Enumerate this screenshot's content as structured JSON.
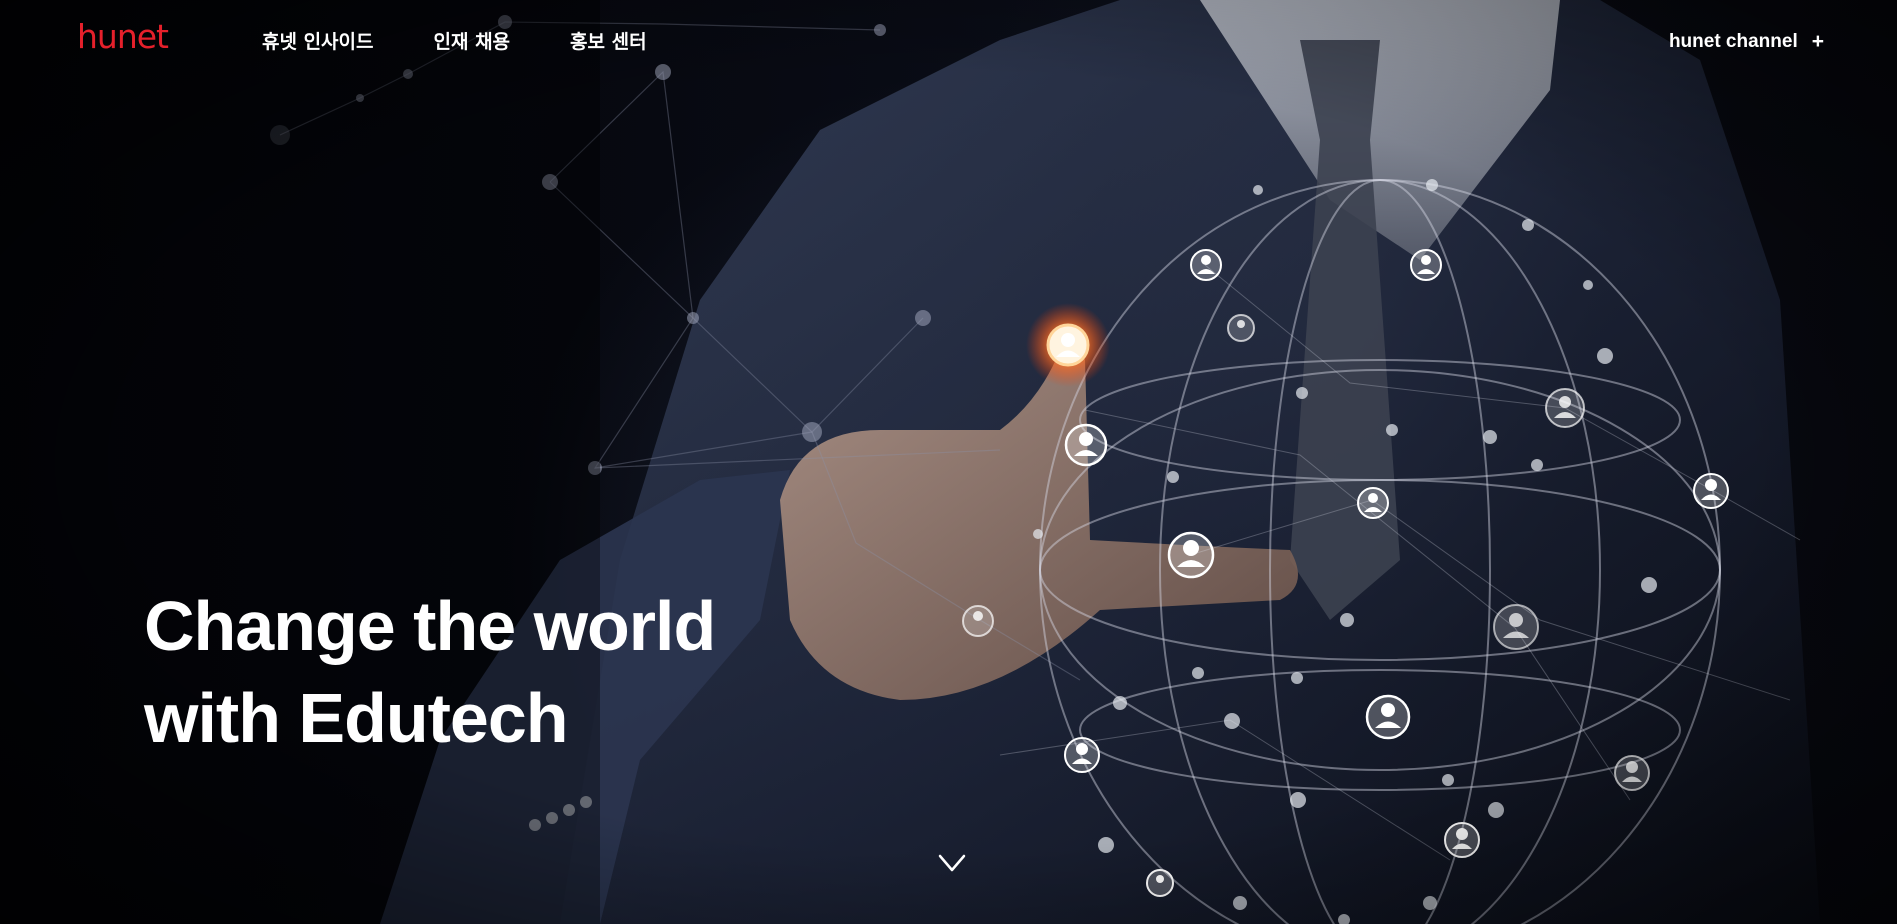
{
  "header": {
    "logo_text": "hunet",
    "nav": [
      {
        "label": "휴넷 인사이드"
      },
      {
        "label": "인재 채용"
      },
      {
        "label": "홍보 센터"
      }
    ],
    "channel_label": "hunet channel",
    "channel_icon": "plus-icon"
  },
  "hero": {
    "headline_line1": "Change the world",
    "headline_line2": "with Edutech",
    "scroll_icon": "chevron-down-icon"
  },
  "colors": {
    "brand": "#e5202b",
    "text": "#ffffff",
    "background": "#05060b"
  }
}
